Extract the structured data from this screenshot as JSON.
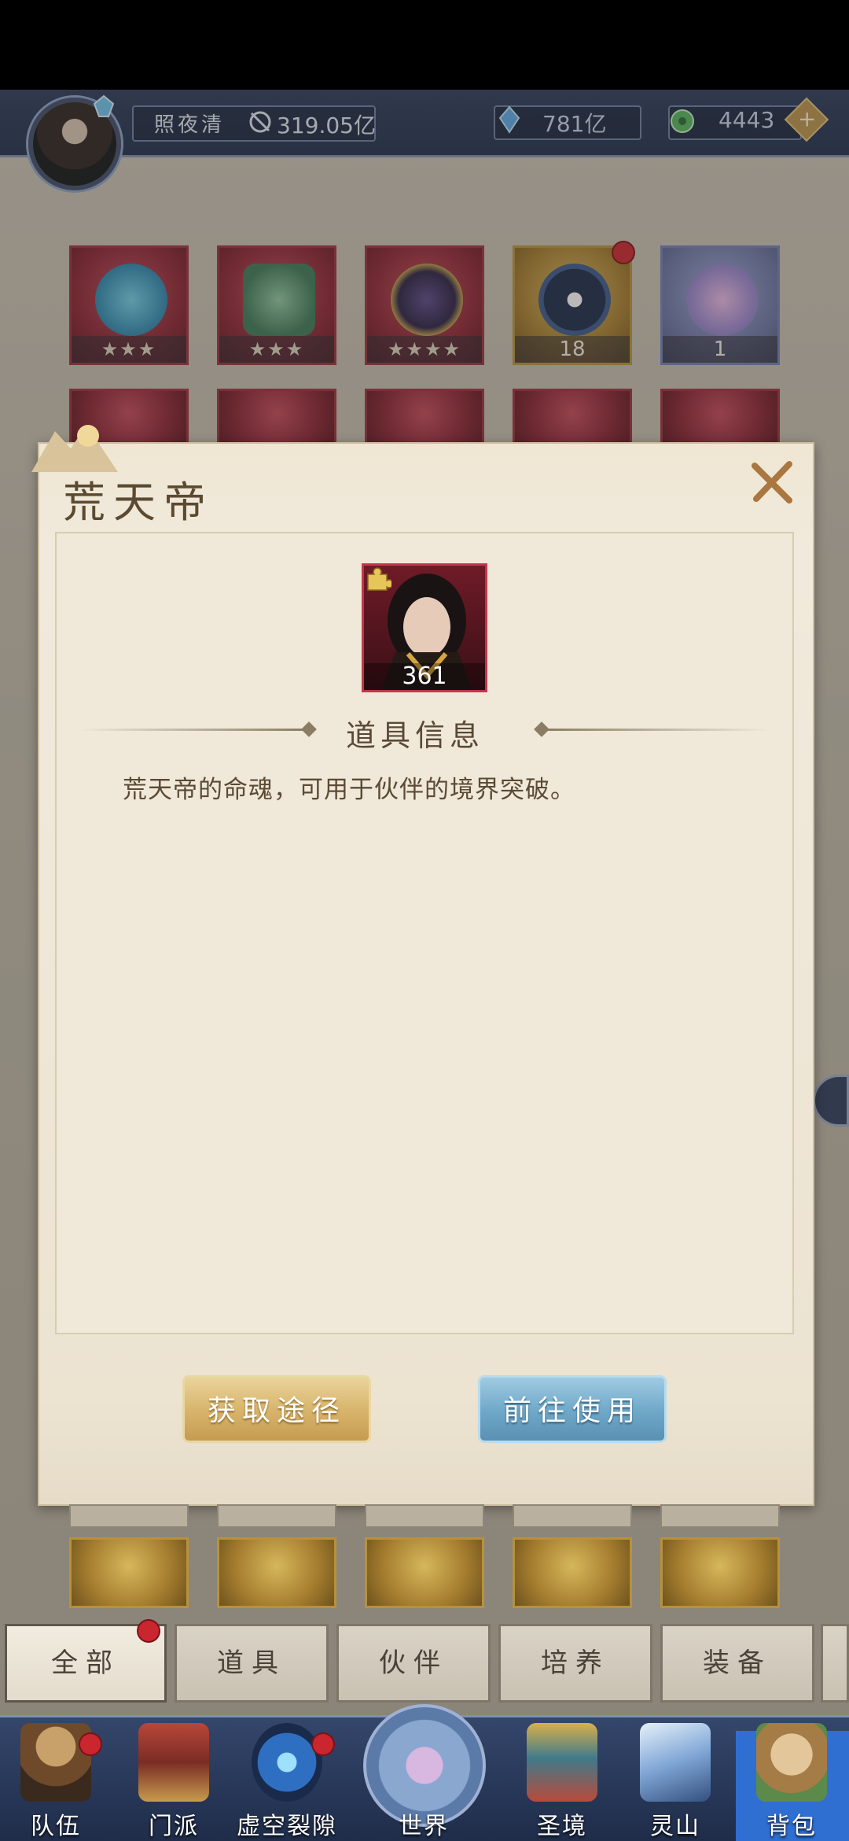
{
  "header": {
    "player_name": "照夜清",
    "power": "319.05亿",
    "currency_crystal": "781亿",
    "currency_jade": "4443",
    "plus_label": "+"
  },
  "grid": {
    "row1": [
      {
        "kind": "red",
        "foot": "★★★"
      },
      {
        "kind": "red",
        "foot": "★★★"
      },
      {
        "kind": "red",
        "foot": "★★★★"
      },
      {
        "kind": "gold",
        "foot": "18"
      },
      {
        "kind": "blue",
        "foot": "1"
      }
    ]
  },
  "modal": {
    "title": "荒天帝",
    "portrait_count": "361",
    "section_title": "道具信息",
    "description": "荒天帝的命魂，可用于伙伴的境界突破。",
    "btn_obtain": "获取途径",
    "btn_use": "前往使用"
  },
  "tabs": [
    {
      "label": "全部"
    },
    {
      "label": "道具"
    },
    {
      "label": "伙伴"
    },
    {
      "label": "培养"
    },
    {
      "label": "装备"
    }
  ],
  "nav": [
    {
      "label": "队伍"
    },
    {
      "label": "门派"
    },
    {
      "label": "虚空裂隙"
    },
    {
      "label": "世界"
    },
    {
      "label": "圣境"
    },
    {
      "label": "灵山"
    },
    {
      "label": "背包"
    }
  ],
  "colors": {
    "accent_gold": "#d7b36a",
    "accent_blue": "#6ea7c8",
    "badge_red": "#c9262f",
    "nav_bg": "#1f2d4a"
  }
}
